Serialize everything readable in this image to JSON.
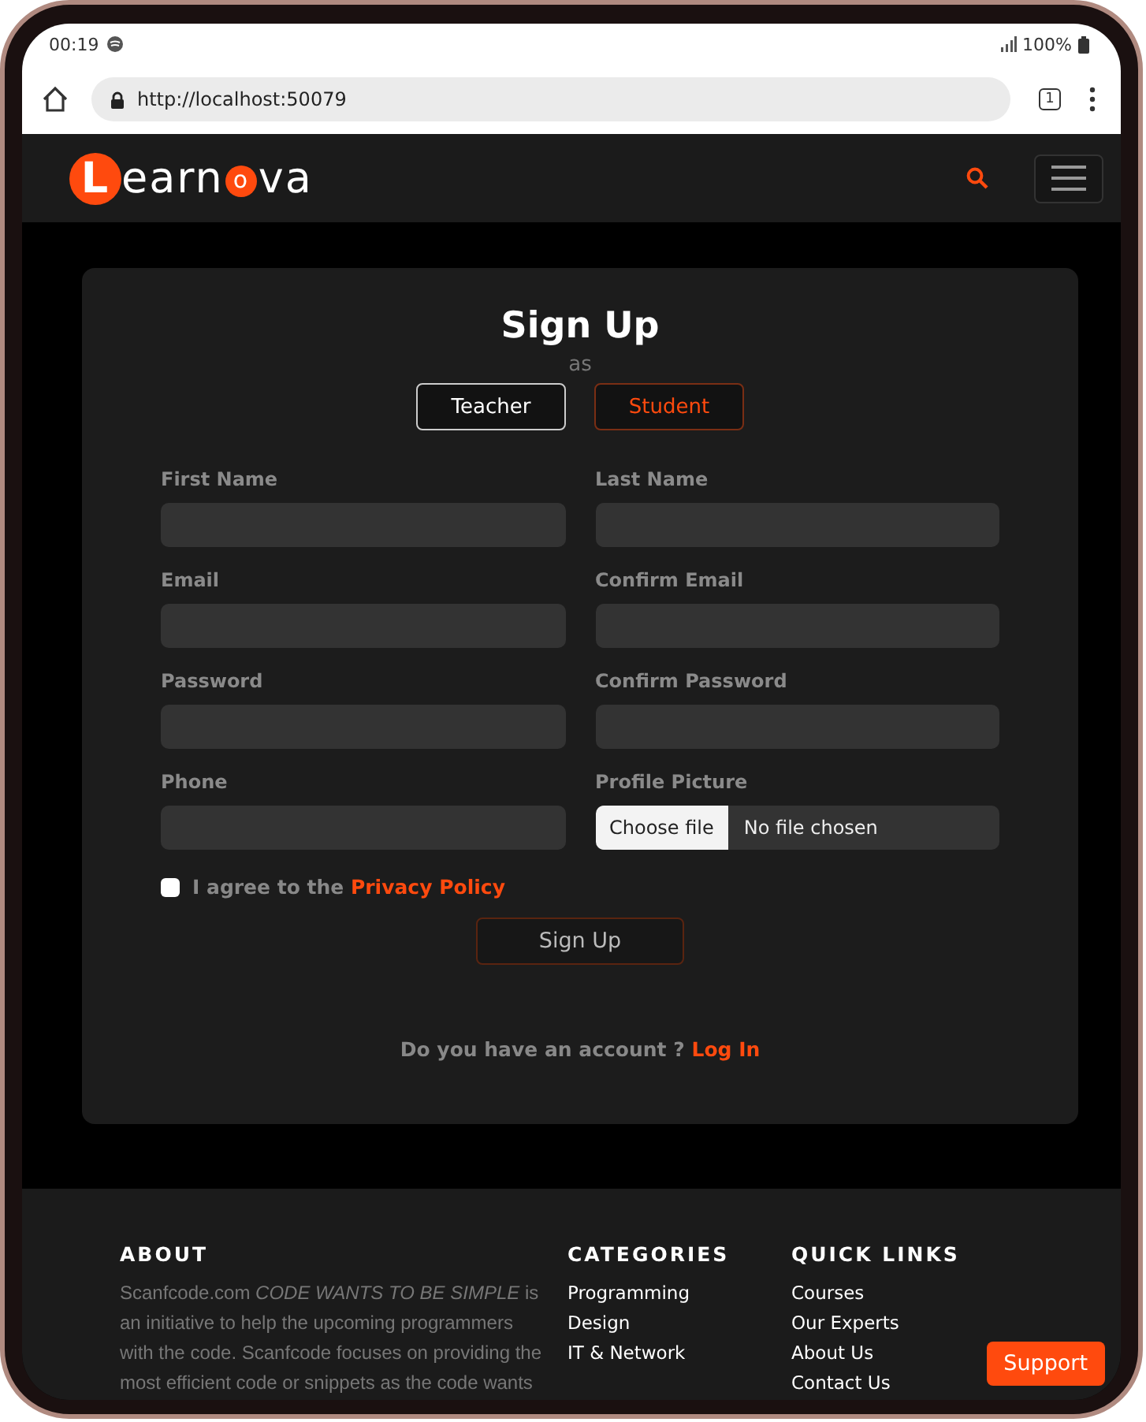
{
  "status_bar": {
    "time": "00:19",
    "battery": "100%"
  },
  "browser": {
    "url": "http://localhost:50079",
    "tab_count": "1"
  },
  "navbar": {
    "logo": [
      "L",
      "earn",
      "o",
      "va"
    ]
  },
  "signup": {
    "title": "Sign Up",
    "subtitle": "as",
    "roles": [
      {
        "label": "Teacher",
        "selected": false
      },
      {
        "label": "Student",
        "selected": true
      }
    ],
    "fields": [
      {
        "label": "First Name",
        "kind": "text"
      },
      {
        "label": "Last Name",
        "kind": "text"
      },
      {
        "label": "Email",
        "kind": "text"
      },
      {
        "label": "Confirm Email",
        "kind": "text"
      },
      {
        "label": "Password",
        "kind": "text"
      },
      {
        "label": "Confirm Password",
        "kind": "text"
      },
      {
        "label": "Phone",
        "kind": "text"
      },
      {
        "label": "Profile Picture",
        "kind": "file",
        "button": "Choose file",
        "value": "No file chosen"
      }
    ],
    "agree": {
      "text": "I agree to the",
      "link": "Privacy Policy",
      "checked": false
    },
    "submit": "Sign Up",
    "login_prompt": {
      "text": "Do you have an account ?",
      "link": "Log In"
    }
  },
  "footer": {
    "about": {
      "title": "ABOUT",
      "text": "Scanfcode.com *CODE WANTS TO BE SIMPLE* is an initiative to help the upcoming programmers with the code. Scanfcode focuses on providing the most efficient code or snippets as the code wants"
    },
    "categories": {
      "title": "CATEGORIES",
      "items": [
        "Programming",
        "Design",
        "IT & Network"
      ]
    },
    "quick_links": {
      "title": "QUICK LINKS",
      "items": [
        "Courses",
        "Our Experts",
        "About Us",
        "Contact Us"
      ]
    }
  },
  "support_button": "Support"
}
